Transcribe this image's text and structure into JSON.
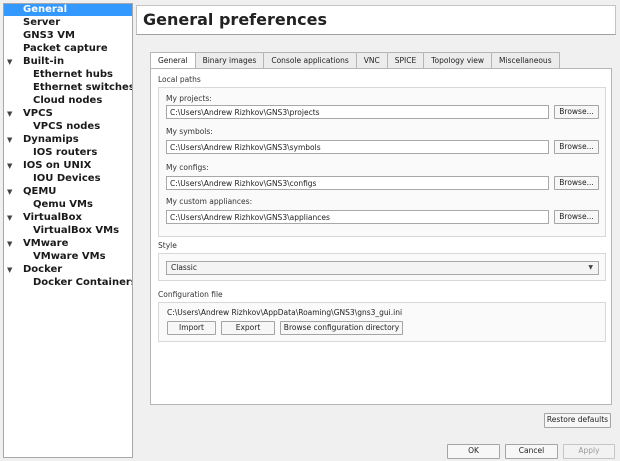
{
  "sidebar": {
    "items": [
      {
        "label": "General",
        "level": 0,
        "expandable": false,
        "selected": true
      },
      {
        "label": "Server",
        "level": 0,
        "expandable": false,
        "selected": false
      },
      {
        "label": "GNS3 VM",
        "level": 0,
        "expandable": false,
        "selected": false
      },
      {
        "label": "Packet capture",
        "level": 0,
        "expandable": false,
        "selected": false
      },
      {
        "label": "Built-in",
        "level": 0,
        "expandable": true,
        "selected": false
      },
      {
        "label": "Ethernet hubs",
        "level": 1,
        "expandable": false,
        "selected": false
      },
      {
        "label": "Ethernet switches",
        "level": 1,
        "expandable": false,
        "selected": false
      },
      {
        "label": "Cloud nodes",
        "level": 1,
        "expandable": false,
        "selected": false
      },
      {
        "label": "VPCS",
        "level": 0,
        "expandable": true,
        "selected": false
      },
      {
        "label": "VPCS nodes",
        "level": 1,
        "expandable": false,
        "selected": false
      },
      {
        "label": "Dynamips",
        "level": 0,
        "expandable": true,
        "selected": false
      },
      {
        "label": "IOS routers",
        "level": 1,
        "expandable": false,
        "selected": false
      },
      {
        "label": "IOS on UNIX",
        "level": 0,
        "expandable": true,
        "selected": false
      },
      {
        "label": "IOU Devices",
        "level": 1,
        "expandable": false,
        "selected": false
      },
      {
        "label": "QEMU",
        "level": 0,
        "expandable": true,
        "selected": false
      },
      {
        "label": "Qemu VMs",
        "level": 1,
        "expandable": false,
        "selected": false
      },
      {
        "label": "VirtualBox",
        "level": 0,
        "expandable": true,
        "selected": false
      },
      {
        "label": "VirtualBox VMs",
        "level": 1,
        "expandable": false,
        "selected": false
      },
      {
        "label": "VMware",
        "level": 0,
        "expandable": true,
        "selected": false
      },
      {
        "label": "VMware VMs",
        "level": 1,
        "expandable": false,
        "selected": false
      },
      {
        "label": "Docker",
        "level": 0,
        "expandable": true,
        "selected": false
      },
      {
        "label": "Docker Containers",
        "level": 1,
        "expandable": false,
        "selected": false
      }
    ]
  },
  "page_title": "General preferences",
  "tabs": [
    "General",
    "Binary images",
    "Console applications",
    "VNC",
    "SPICE",
    "Topology view",
    "Miscellaneous"
  ],
  "active_tab": 0,
  "local_paths": {
    "section_label": "Local paths",
    "projects": {
      "label": "My projects:",
      "value": "C:\\Users\\Andrew Rizhkov\\GNS3\\projects",
      "browse": "Browse..."
    },
    "symbols": {
      "label": "My symbols:",
      "value": "C:\\Users\\Andrew Rizhkov\\GNS3\\symbols",
      "browse": "Browse..."
    },
    "configs": {
      "label": "My configs:",
      "value": "C:\\Users\\Andrew Rizhkov\\GNS3\\configs",
      "browse": "Browse..."
    },
    "appliances": {
      "label": "My custom appliances:",
      "value": "C:\\Users\\Andrew Rizhkov\\GNS3\\appliances",
      "browse": "Browse..."
    }
  },
  "style": {
    "section_label": "Style",
    "selected": "Classic"
  },
  "config_file": {
    "section_label": "Configuration file",
    "path": "C:\\Users\\Andrew Rizhkov\\AppData\\Roaming\\GNS3\\gns3_gui.ini",
    "import_label": "Import",
    "export_label": "Export",
    "browse_dir_label": "Browse configuration directory"
  },
  "restore_defaults_label": "Restore defaults",
  "footer": {
    "ok_label": "OK",
    "cancel_label": "Cancel",
    "apply_label": "Apply"
  },
  "colors": {
    "selection": "#3399ff",
    "window_bg": "#f0f0f0"
  }
}
